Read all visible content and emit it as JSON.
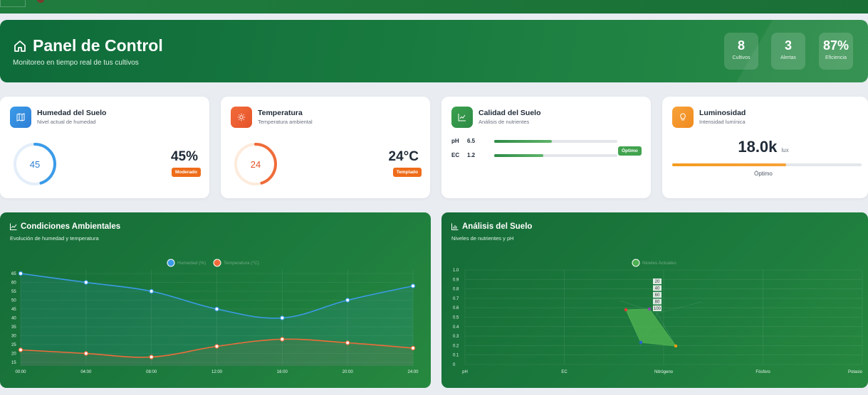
{
  "header": {
    "title": "Panel de Control",
    "subtitle": "Monitoreo en tiempo real de tus cultivos"
  },
  "stats": [
    {
      "value": "8",
      "label": "Cultivos"
    },
    {
      "value": "3",
      "label": "Alertas"
    },
    {
      "value": "87%",
      "label": "Eficiencia"
    }
  ],
  "cards": {
    "humidity": {
      "title": "Humedad del Suelo",
      "subtitle": "Nivel actual de humedad",
      "gauge": "45",
      "value": "45%",
      "badge": "Moderado",
      "level": 0.45
    },
    "temperature": {
      "title": "Temperatura",
      "subtitle": "Temperatura ambiental",
      "gauge": "24",
      "value": "24°C",
      "badge": "Templado",
      "level": 0.45
    },
    "quality": {
      "title": "Calidad del Suelo",
      "subtitle": "Análisis de nutrientes",
      "ph_label": "pH",
      "ph_value": "6.5",
      "ph_level": 0.47,
      "ec_label": "EC",
      "ec_value": "1.2",
      "ec_level": 0.4,
      "badge": "Óptimo"
    },
    "light": {
      "title": "Luminosidad",
      "subtitle": "Intensidad lumínica",
      "value": "18.0k",
      "unit": "lux",
      "level": 0.6,
      "status": "Óptimo"
    }
  },
  "colors": {
    "humidity": "#3b9be8",
    "temperature": "#ef6c3a",
    "green": "#2e8b46",
    "light": "#f7a23a"
  },
  "panels": {
    "env": {
      "title": "Condiciones Ambientales",
      "subtitle": "Evolución de humedad y temperatura"
    },
    "soil": {
      "title": "Análisis del Suelo",
      "subtitle": "Niveles de nutrientes y pH"
    }
  },
  "chart_data": [
    {
      "type": "line",
      "title": "",
      "x": [
        "00:00",
        "04:00",
        "08:00",
        "12:00",
        "16:00",
        "20:00",
        "24:00"
      ],
      "series": [
        {
          "name": "Humedad (%)",
          "values": [
            65,
            60,
            55,
            45,
            40,
            50,
            58
          ]
        },
        {
          "name": "Temperatura (°C)",
          "values": [
            22,
            20,
            18,
            24,
            28,
            26,
            23
          ]
        }
      ],
      "yticks": [
        15,
        20,
        25,
        30,
        35,
        40,
        45,
        50,
        55,
        60,
        65
      ],
      "ylim": [
        13,
        67
      ],
      "grid": true,
      "legend": "top"
    },
    {
      "type": "radar",
      "title": "",
      "categories": [
        "pH",
        "EC",
        "Nitrógeno",
        "Fósforo",
        "Potasio"
      ],
      "series": [
        {
          "name": "Niveles Actuales"
        }
      ],
      "yticks": [
        "0",
        "0.1",
        "0.2",
        "0.3",
        "0.4",
        "0.5",
        "0.6",
        "0.7",
        "0.8",
        "0.9",
        "1.0"
      ],
      "radial_ticks": [
        "20",
        "40",
        "60",
        "80",
        "100"
      ],
      "grid": true,
      "legend": "top"
    }
  ]
}
